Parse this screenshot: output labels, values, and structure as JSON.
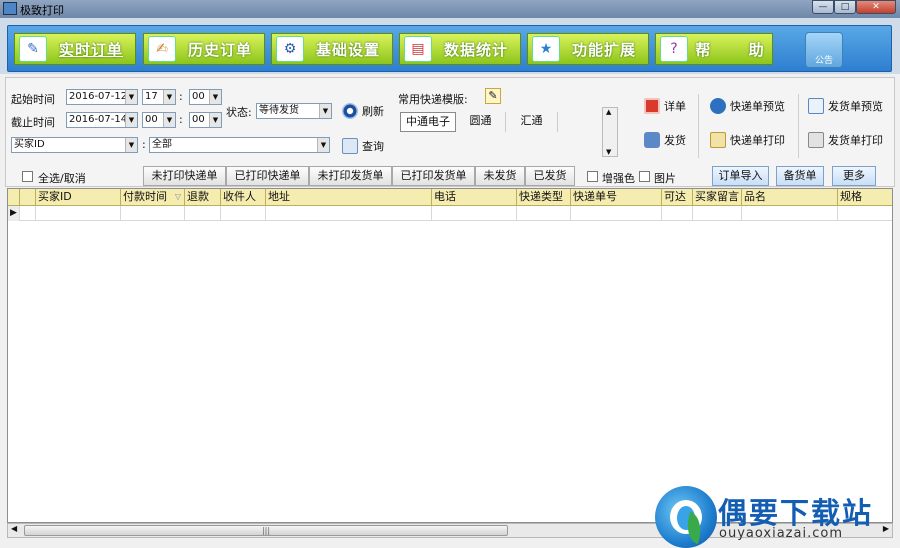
{
  "window": {
    "title": "极致打印"
  },
  "nav": [
    {
      "label": "实时订单",
      "icon": "order-icon",
      "active": true
    },
    {
      "label": "历史订单",
      "icon": "history-icon",
      "active": false
    },
    {
      "label": "基础设置",
      "icon": "settings-gear-icon",
      "active": false
    },
    {
      "label": "数据统计",
      "icon": "statistics-chart-icon",
      "active": false
    },
    {
      "label": "功能扩展",
      "icon": "extension-icon",
      "active": false
    },
    {
      "label": "帮      助",
      "icon": "help-icon",
      "active": false
    }
  ],
  "notice": {
    "label": "公告"
  },
  "filters": {
    "start_label": "起始时间",
    "start_date": "2016-07-12",
    "start_hour": "17",
    "start_min": "00",
    "end_label": "截止时间",
    "end_date": "2016-07-14",
    "end_hour": "00",
    "end_min": "00",
    "colon": ":",
    "status_label": "状态:",
    "status_value": "等待发货",
    "field_select": "买家ID",
    "field_value": "全部",
    "refresh_label": "刷新",
    "query_label": "查询"
  },
  "templates": {
    "label": "常用快递模版:",
    "items": [
      "中通电子",
      "圆通",
      "汇通"
    ]
  },
  "actions": {
    "detail": "详单",
    "ship": "发货",
    "express_preview": "快递单预览",
    "express_print": "快递单打印",
    "invoice_preview": "发货单预览",
    "invoice_print": "发货单打印"
  },
  "filterbar": {
    "select_all": "全选/取消",
    "tabs": [
      "未打印快递单",
      "已打印快递单",
      "未打印发货单",
      "已打印发货单",
      "未发货",
      "已发货"
    ],
    "enhance_color": "增强色",
    "image": "图片",
    "import_orders": "订单导入",
    "stock_list": "备货单",
    "more": "更多"
  },
  "grid": {
    "columns": [
      "买家ID",
      "付款时间",
      "退款",
      "收件人",
      "地址",
      "电话",
      "快递类型",
      "快递单号",
      "可达",
      "买家留言",
      "品名",
      "规格"
    ]
  },
  "scrollbar": {
    "grip": "|||"
  },
  "watermark": {
    "title": "偶要下载站",
    "url": "ouyaoxiazai.com"
  }
}
